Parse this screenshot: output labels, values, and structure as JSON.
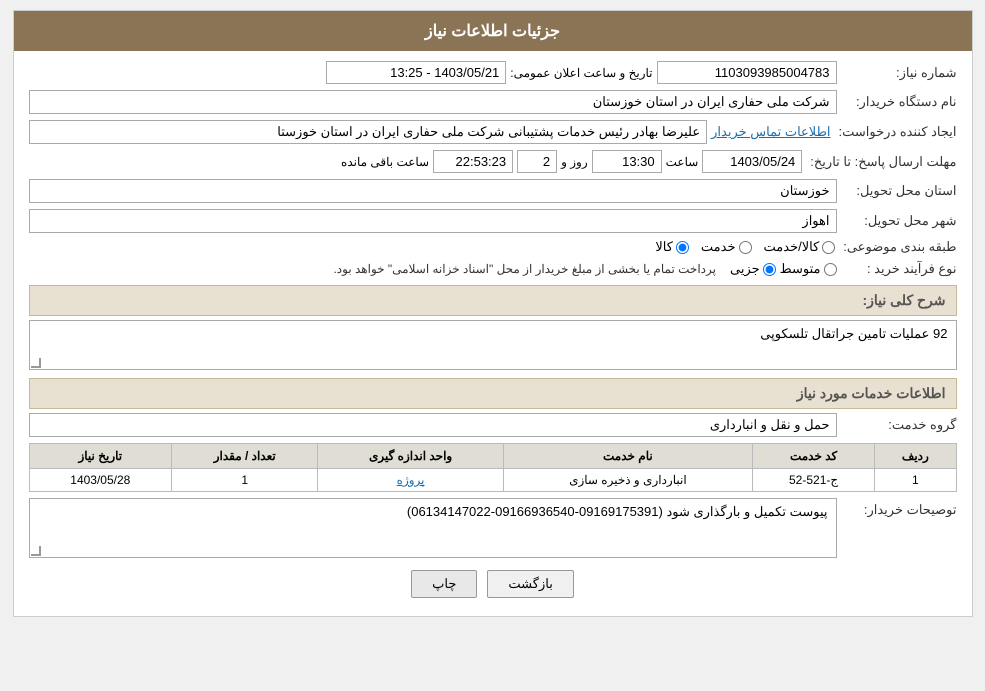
{
  "header": {
    "title": "جزئیات اطلاعات نیاز"
  },
  "fields": {
    "need_number_label": "شماره نیاز:",
    "need_number_value": "1103093985004783",
    "announcement_date_label": "تاریخ و ساعت اعلان عمومی:",
    "announcement_date_value": "1403/05/21 - 13:25",
    "buyer_org_label": "نام دستگاه خریدار:",
    "buyer_org_value": "شرکت ملی حفاری ایران در استان خوزستان",
    "requester_label": "ایجاد کننده درخواست:",
    "requester_value": "علیرضا بهادر رئیس خدمات پشتیبانی شرکت ملی حفاری ایران در استان خوزستا",
    "requester_link": "اطلاعات تماس خریدار",
    "response_deadline_label": "مهلت ارسال پاسخ: تا تاریخ:",
    "response_date": "1403/05/24",
    "response_time_label": "ساعت",
    "response_time": "13:30",
    "response_days_label": "روز و",
    "response_days": "2",
    "response_remaining_label": "ساعت باقی مانده",
    "response_remaining": "22:53:23",
    "delivery_province_label": "استان محل تحویل:",
    "delivery_province": "خوزستان",
    "delivery_city_label": "شهر محل تحویل:",
    "delivery_city": "اهواز",
    "category_label": "طبقه بندی موضوعی:",
    "category_options": [
      "کالا",
      "خدمت",
      "کالا/خدمت"
    ],
    "category_selected": "کالا",
    "purchase_type_label": "نوع فرآیند خرید :",
    "purchase_type_options": [
      "جزیی",
      "متوسط"
    ],
    "purchase_type_note": "پرداخت تمام یا بخشی از مبلغ خریدار از محل \"اسناد خزانه اسلامی\" خواهد بود.",
    "need_description_label": "شرح کلی نیاز:",
    "need_description_value": "92 عملیات تامین جراتقال تلسکوپی",
    "services_section_label": "اطلاعات خدمات مورد نیاز",
    "service_group_label": "گروه خدمت:",
    "service_group_value": "حمل و نقل و انبارداری",
    "table": {
      "headers": [
        "ردیف",
        "کد خدمت",
        "نام خدمت",
        "واحد اندازه گیری",
        "تعداد / مقدار",
        "تاریخ نیاز"
      ],
      "rows": [
        {
          "row": "1",
          "code": "ج-521-52",
          "name": "انبارداری و ذخیره سازی",
          "unit": "پروژه",
          "quantity": "1",
          "date": "1403/05/28"
        }
      ]
    },
    "buyer_description_label": "توصیحات خریدار:",
    "buyer_description_value": "پیوست تکمیل و بارگذاری شود (09169175391-09166936540-06134147022)"
  },
  "buttons": {
    "print": "چاپ",
    "back": "بازگشت"
  }
}
